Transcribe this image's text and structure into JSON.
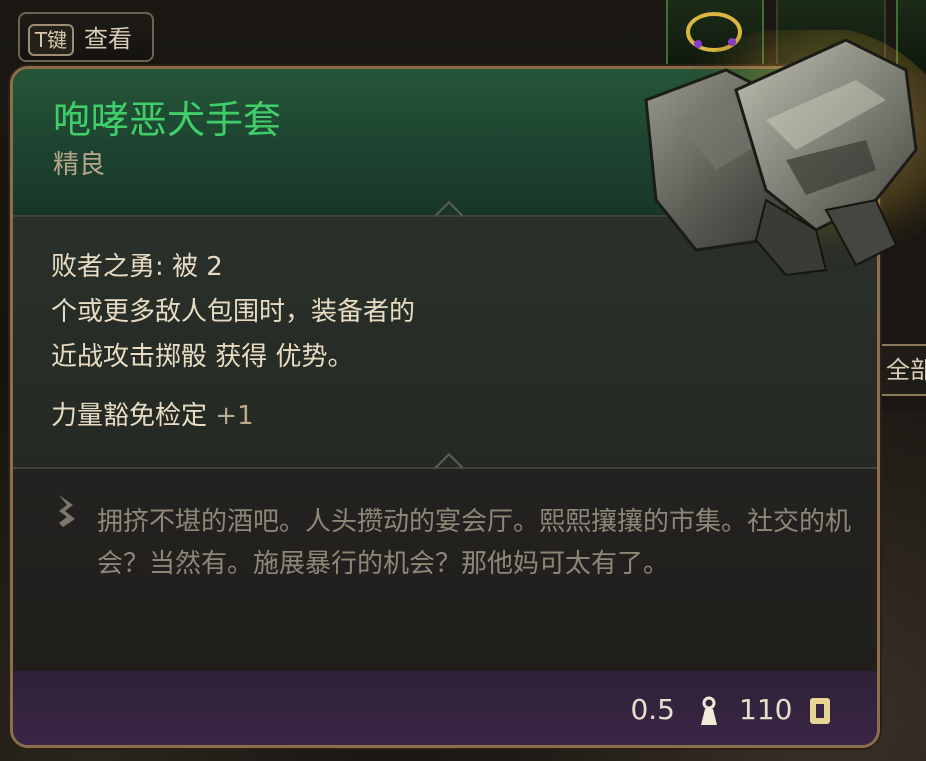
{
  "hint": {
    "key": "T键",
    "label": "查看"
  },
  "side_button": {
    "label": "全部"
  },
  "item": {
    "name": "咆哮恶犬手套",
    "rarity": "精良",
    "effect_lines": [
      "败者之勇: 被 2",
      "个或更多敌人包围时，装备者的",
      "近战攻击掷骰 获得 优势。"
    ],
    "bonus_label": "力量豁免检定",
    "bonus_value": "+1",
    "description": "拥挤不堪的酒吧。人头攒动的宴会厅。熙熙攘攘的市集。社交的机会？当然有。施展暴行的机会？那他妈可太有了。",
    "weight": "0.5",
    "price": "110"
  },
  "icons": {
    "weight": "weight-icon",
    "price": "gold-coin-icon",
    "quill": "quill-icon",
    "gauntlet": "gauntlet-image"
  },
  "colors": {
    "name_green": "#3fcf6a",
    "rarity_text": "#b6a78a",
    "border_gold": "#8b6f4c",
    "footer_purple": "#3a2646"
  }
}
